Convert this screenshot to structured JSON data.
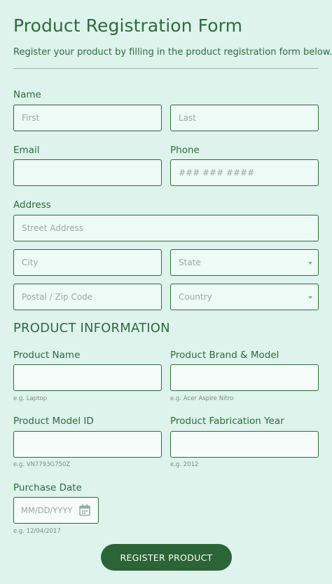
{
  "form": {
    "title": "Product Registration Form",
    "subtitle": "Register your product by filling in the product registration form below."
  },
  "name": {
    "label": "Name",
    "first_placeholder": "First",
    "last_placeholder": "Last"
  },
  "email": {
    "label": "Email",
    "placeholder": ""
  },
  "phone": {
    "label": "Phone",
    "placeholder": "### ### ####"
  },
  "address": {
    "label": "Address",
    "street_placeholder": "Street Address",
    "city_placeholder": "City",
    "state_selected": "State",
    "zip_placeholder": "Postal / Zip Code",
    "country_selected": "Country"
  },
  "product_info": {
    "heading": "PRODUCT INFORMATION",
    "product_name": {
      "label": "Product Name",
      "hint": "e.g. Laptop"
    },
    "brand_model": {
      "label": "Product Brand & Model",
      "hint": "e.g. Acer Aspire Nitro"
    },
    "model_id": {
      "label": "Product Model ID",
      "hint": "e.g. VN7793G750Z"
    },
    "fabrication_year": {
      "label": "Product Fabrication Year",
      "hint": "e.g. 2012"
    },
    "purchase_date": {
      "label": "Purchase Date",
      "placeholder": "MM/DD/YYYY",
      "hint": "e.g. 12/04/2017"
    }
  },
  "submit": {
    "label": "REGISTER PRODUCT"
  },
  "colors": {
    "background": "#ddf3ec",
    "accent": "#2f6b3b",
    "button": "#2b6436"
  },
  "icons": {
    "date_picker": "calendar-icon",
    "select": "chevron-down-icon"
  }
}
